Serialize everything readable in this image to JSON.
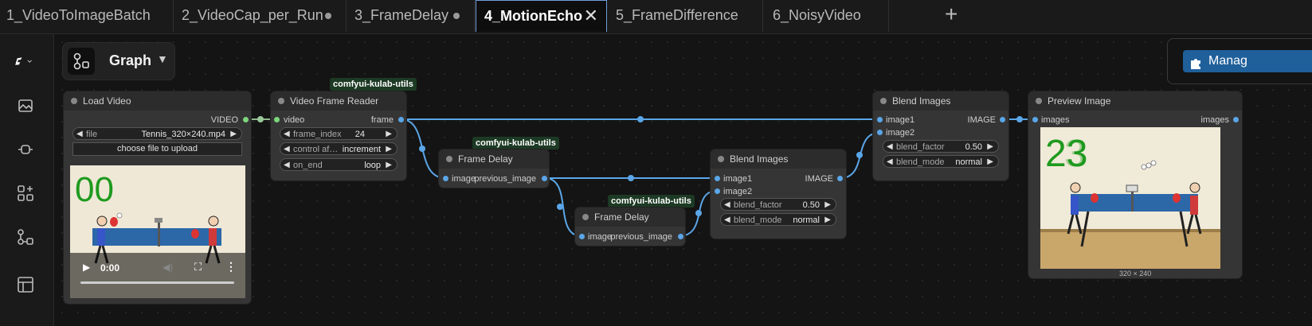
{
  "tabs": [
    {
      "label": "1_VideoToImageBatch"
    },
    {
      "label": "2_VideoCap_per_Run"
    },
    {
      "label": "3_FrameDelay"
    },
    {
      "label": "4_MotionEcho"
    },
    {
      "label": "5_FrameDifference"
    },
    {
      "label": "6_NoisyVideo"
    }
  ],
  "graph_switch": {
    "label": "Graph"
  },
  "manager": {
    "label": "Manag"
  },
  "nodes": {
    "load_video": {
      "title": "Load Video",
      "output": "VIDEO",
      "file_label": "file",
      "file_value": "Tennis_320×240.mp4",
      "upload": "choose file to upload",
      "overlay_number": "00",
      "time": "0:00"
    },
    "reader": {
      "badge": "comfyui-kulab-utils",
      "title": "Video Frame Reader",
      "input": "video",
      "output": "frame",
      "w1_label": "frame_index",
      "w1_value": "24",
      "w2_label": "control af…",
      "w2_value": "increment",
      "w3_label": "on_end",
      "w3_value": "loop"
    },
    "delay1": {
      "badge": "comfyui-kulab-utils",
      "title": "Frame Delay",
      "input": "image",
      "output": "previous_image"
    },
    "delay2": {
      "badge": "comfyui-kulab-utils",
      "title": "Frame Delay",
      "input": "image",
      "output": "previous_image"
    },
    "blend1": {
      "title": "Blend Images",
      "in1": "image1",
      "in2": "image2",
      "output": "IMAGE",
      "w1_label": "blend_factor",
      "w1_value": "0.50",
      "w2_label": "blend_mode",
      "w2_value": "normal"
    },
    "blend2": {
      "title": "Blend Images",
      "in1": "image1",
      "in2": "image2",
      "output": "IMAGE",
      "w1_label": "blend_factor",
      "w1_value": "0.50",
      "w2_label": "blend_mode",
      "w2_value": "normal"
    },
    "preview": {
      "title": "Preview Image",
      "input": "images",
      "output": "images",
      "overlay_number": "23",
      "size": "320 × 240"
    }
  },
  "colors": {
    "wire": "#5aa6e8",
    "badge_bg": "#1d3a24",
    "counter": "#1e9a1e"
  }
}
